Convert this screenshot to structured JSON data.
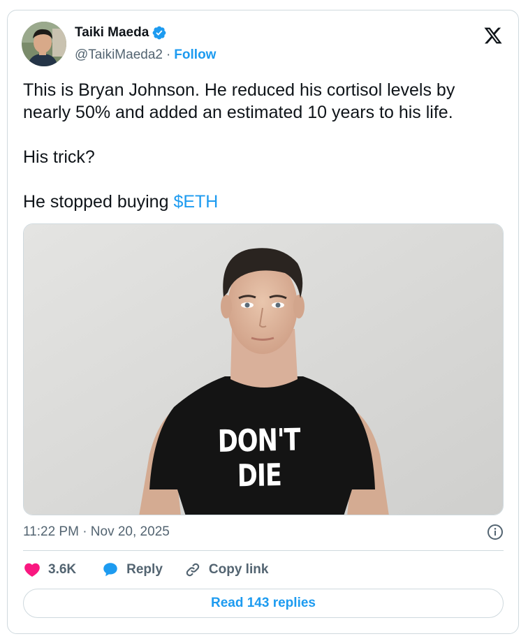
{
  "author": {
    "display_name": "Taiki Maeda",
    "handle": "@TaikiMaeda2",
    "separator": "·",
    "follow_label": "Follow",
    "avatar_icon": "avatar-photo",
    "verified_icon": "verified-badge-icon"
  },
  "platform_logo": "x-logo-icon",
  "tweet": {
    "line1": "This is Bryan Johnson. He reduced his cortisol levels by nearly 50% and added an estimated 10 years to his life.",
    "line2": "His trick?",
    "line3_prefix": "He stopped buying ",
    "cashtag": "$ETH"
  },
  "media": {
    "shirt_text": "DON'T DIE"
  },
  "timestamp": "11:22 PM · Nov 20, 2025",
  "actions": {
    "like_count": "3.6K",
    "reply_label": "Reply",
    "copy_link_label": "Copy link"
  },
  "read_replies_label": "Read 143 replies",
  "colors": {
    "accent": "#1d9bf0",
    "like": "#f91880",
    "text_primary": "#0f1419",
    "text_secondary": "#536471",
    "border": "#cfd9de"
  }
}
